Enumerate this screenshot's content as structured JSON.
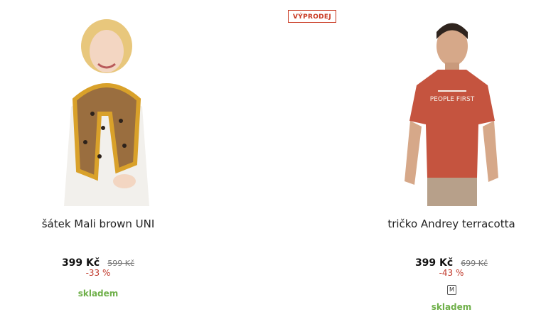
{
  "products": [
    {
      "title": "šátek Mali brown UNI",
      "price_now": "399 Kč",
      "price_old": "599 Kč",
      "discount": "-33 %",
      "stock": "skladem",
      "badge": "",
      "size": ""
    },
    {
      "title": "tričko Andrey terracotta",
      "price_now": "399 Kč",
      "price_old": "699 Kč",
      "discount": "-43 %",
      "stock": "skladem",
      "badge": "VÝPRODEJ",
      "size": "M"
    }
  ],
  "colors": {
    "sale_red": "#c8371f",
    "stock_green": "#6fb04a",
    "scarf_mustard": "#d9a12a",
    "shirt_terracotta": "#c5543f"
  },
  "icons": [
    "scarf-product-image",
    "tshirt-product-image"
  ]
}
